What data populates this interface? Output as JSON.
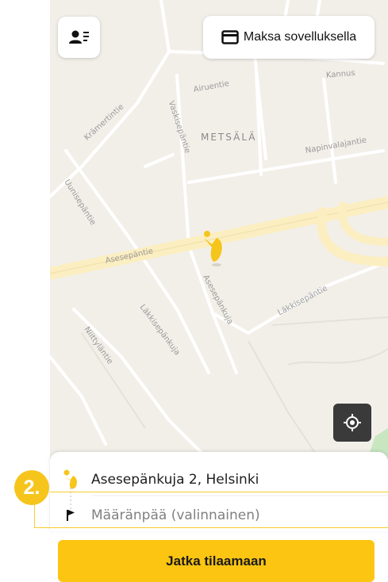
{
  "top_bar": {
    "profile_icon": "user-card-icon",
    "pay_icon": "credit-card-icon",
    "pay_label": "Maksa sovelluksella"
  },
  "map": {
    "district": "METSÄLÄ",
    "streets": {
      "airuentie": "Airuentie",
      "kannus": "Kannus",
      "kramertintie": "Krämertintie",
      "vaskisepantie": "Vaskisepäntie",
      "napinvalajantie": "Napinvalajantie",
      "uunisepantie": "Uunisepäntie",
      "asesepantie": "Asesepäntie",
      "asesepankuja": "Asesepänkuja",
      "lakkisepantie": "Läkkisepäntie",
      "lakkisepankuja": "Läkkisepänkuja",
      "niittylantie": "Niittyläntie"
    },
    "pin_icon": "pickup-pin-icon",
    "locate_icon": "my-location-icon"
  },
  "route": {
    "from_icon": "pickup-person-icon",
    "from_value": "Asesepänkuja 2, Helsinki",
    "to_icon": "destination-flag-icon",
    "to_placeholder": "Määränpää (valinnainen)"
  },
  "step": {
    "number": "2."
  },
  "cta": {
    "label": "Jatka tilaamaan"
  },
  "colors": {
    "accent": "#fcc512",
    "guide": "#f6cd2c",
    "map_bg": "#f2efe9",
    "main_road": "#fbeec1"
  }
}
